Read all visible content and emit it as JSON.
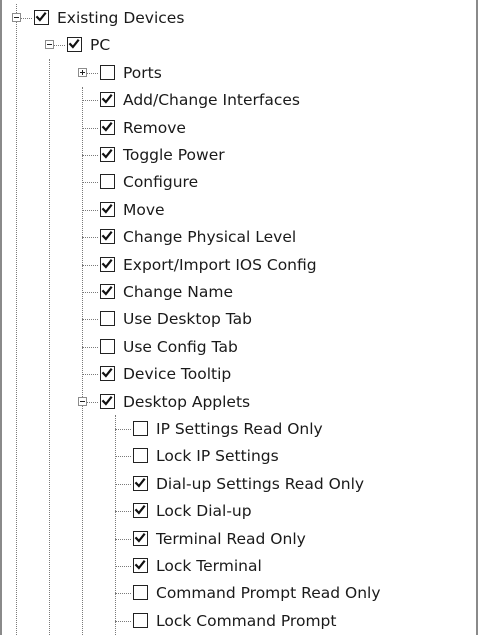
{
  "tree": [
    {
      "label": "Existing Devices",
      "checked": true,
      "depth": 0,
      "expander": "expanded",
      "last": false
    },
    {
      "label": "PC",
      "checked": true,
      "depth": 1,
      "expander": "expanded",
      "last": false
    },
    {
      "label": "Ports",
      "checked": false,
      "depth": 2,
      "expander": "collapsed",
      "last": false
    },
    {
      "label": "Add/Change Interfaces",
      "checked": true,
      "depth": 2,
      "expander": null,
      "last": false
    },
    {
      "label": "Remove",
      "checked": true,
      "depth": 2,
      "expander": null,
      "last": false
    },
    {
      "label": "Toggle Power",
      "checked": true,
      "depth": 2,
      "expander": null,
      "last": false
    },
    {
      "label": "Configure",
      "checked": false,
      "depth": 2,
      "expander": null,
      "last": false
    },
    {
      "label": "Move",
      "checked": true,
      "depth": 2,
      "expander": null,
      "last": false
    },
    {
      "label": "Change Physical Level",
      "checked": true,
      "depth": 2,
      "expander": null,
      "last": false
    },
    {
      "label": "Export/Import IOS Config",
      "checked": true,
      "depth": 2,
      "expander": null,
      "last": false
    },
    {
      "label": "Change Name",
      "checked": true,
      "depth": 2,
      "expander": null,
      "last": false
    },
    {
      "label": "Use Desktop Tab",
      "checked": false,
      "depth": 2,
      "expander": null,
      "last": false
    },
    {
      "label": "Use Config Tab",
      "checked": false,
      "depth": 2,
      "expander": null,
      "last": false
    },
    {
      "label": "Device Tooltip",
      "checked": true,
      "depth": 2,
      "expander": null,
      "last": false
    },
    {
      "label": "Desktop Applets",
      "checked": true,
      "depth": 2,
      "expander": "expanded",
      "last": false
    },
    {
      "label": "IP Settings Read Only",
      "checked": false,
      "depth": 3,
      "expander": null,
      "last": false
    },
    {
      "label": "Lock IP Settings",
      "checked": false,
      "depth": 3,
      "expander": null,
      "last": false
    },
    {
      "label": "Dial-up Settings Read Only",
      "checked": true,
      "depth": 3,
      "expander": null,
      "last": false
    },
    {
      "label": "Lock Dial-up",
      "checked": true,
      "depth": 3,
      "expander": null,
      "last": false
    },
    {
      "label": "Terminal Read Only",
      "checked": true,
      "depth": 3,
      "expander": null,
      "last": false
    },
    {
      "label": "Lock Terminal",
      "checked": true,
      "depth": 3,
      "expander": null,
      "last": false
    },
    {
      "label": "Command Prompt Read Only",
      "checked": false,
      "depth": 3,
      "expander": null,
      "last": false
    },
    {
      "label": "Lock Command Prompt",
      "checked": false,
      "depth": 3,
      "expander": null,
      "last": false
    }
  ]
}
